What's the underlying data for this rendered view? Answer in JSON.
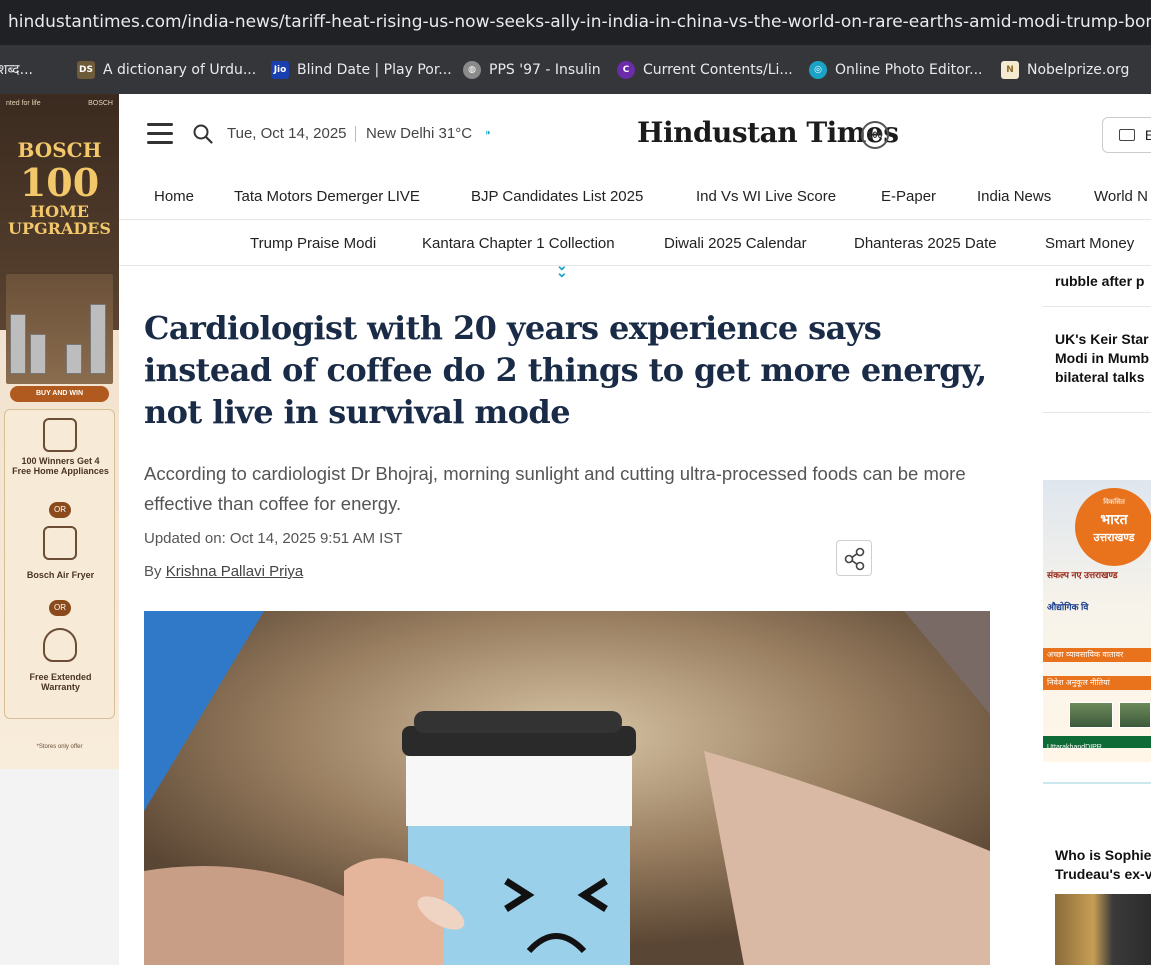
{
  "browser": {
    "url": "hindustantimes.com/india-news/tariff-heat-rising-us-now-seeks-ally-in-india-in-china-vs-the-world-on-rare-earths-amid-modi-trump-bonhomie...",
    "bookmarks": [
      {
        "label": "शब्द...",
        "icon": "text-icon",
        "color": "#35363a"
      },
      {
        "label": "A dictionary of Urdu...",
        "icon": "dsal-icon",
        "color": "#6d5b3a"
      },
      {
        "label": "Blind Date | Play Por...",
        "icon": "jio-icon",
        "color": "#1a3fb0"
      },
      {
        "label": "PPS '97 - Insulin",
        "icon": "globe-icon",
        "color": "#8a8a8a"
      },
      {
        "label": "Current Contents/Li...",
        "icon": "clarivate-icon",
        "color": "#6a2ca8"
      },
      {
        "label": "Online Photo Editor...",
        "icon": "photo-editor-icon",
        "color": "#1aa3c7"
      },
      {
        "label": "Nobelprize.org",
        "icon": "nobel-icon",
        "color": "#c8a34a"
      }
    ]
  },
  "left_ad": {
    "brand_left": "nted for life",
    "brand_right": "BOSCH",
    "line1": "BOSCH",
    "line2": "100",
    "line3": "HOME",
    "line4": "UPGRADES",
    "cta": "BUY AND WIN",
    "offer1": "100 Winners Get 4 Free Home Appliances",
    "or": "OR",
    "offer2": "Bosch Air Fryer",
    "offer3": "Free Extended Warranty",
    "footnote": "*Stores only offer"
  },
  "header": {
    "date": "Tue, Oct 14, 2025",
    "weather": "New Delhi 31°C",
    "logo": "Hindustan Times",
    "logo_badge": "100",
    "epaper_label": "E"
  },
  "nav_primary": [
    "Home",
    "Tata Motors Demerger LIVE",
    "BJP Candidates List 2025",
    "Ind Vs WI Live Score",
    "E-Paper",
    "India News",
    "World N"
  ],
  "nav_secondary": [
    "Trump Praise Modi",
    "Kantara Chapter 1 Collection",
    "Diwali 2025 Calendar",
    "Dhanteras 2025 Date",
    "Smart Money"
  ],
  "article": {
    "headline": "Cardiologist with 20 years experience says instead of coffee do 2 things to get more energy, not live in survival mode",
    "summary": "According to cardiologist Dr Bhojraj, morning sunlight and cutting ultra-processed foods can be more effective than coffee for energy.",
    "updated": "Updated on: Oct 14, 2025 9:51 AM IST",
    "by_prefix": "By",
    "author": "Krishna Pallavi Priya"
  },
  "rail": {
    "item1": "rubble after p",
    "item2_lines": [
      "UK's Keir Star",
      "Modi in Mumb",
      "bilateral talks"
    ],
    "bottom_lines": [
      "Who is Sophie",
      "Trudeau's ex-v"
    ]
  },
  "right_ad": {
    "seal_top": "विकसित",
    "seal_mid": "भारत",
    "seal_name": "उत्तराखण्ड",
    "tagline": "संकल्प नए उत्तराखण्ड",
    "row1": "औद्योगिक वि",
    "row2": "अच्छा व्यावसायिक वातावर",
    "row3": "निवेश अनुकूल नीतियां",
    "handle": "UttarakhandDIPR"
  }
}
